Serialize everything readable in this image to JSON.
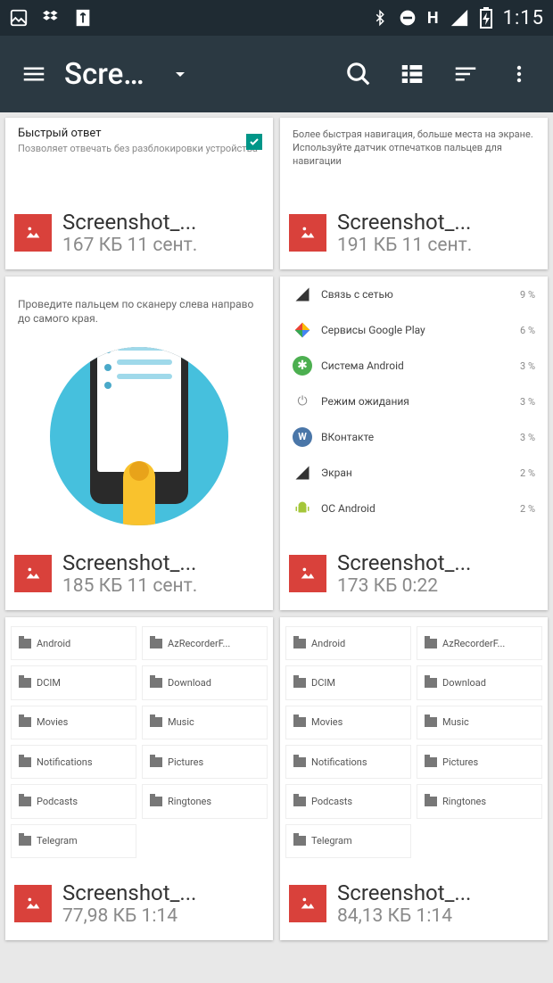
{
  "status": {
    "clock": "1:15",
    "network_label": "H"
  },
  "appbar": {
    "title": "Scre…"
  },
  "cards": [
    {
      "name": "Screenshot_...",
      "size": "167 КБ",
      "date": "11 сент.",
      "pv1": {
        "title": "Быстрый ответ",
        "subtitle": "Позволяет отвечать без разблокировки устройства"
      }
    },
    {
      "name": "Screenshot_...",
      "size": "191 КБ",
      "date": "11 сент.",
      "pv2": {
        "text": "Более быстрая навигация, больше места на экране. Используйте датчик отпечатков пальцев для навигации"
      }
    },
    {
      "name": "Screenshot_...",
      "size": "185 КБ",
      "date": "11 сент.",
      "pv3": {
        "hint": "Проведите пальцем по сканеру слева направо до самого края."
      }
    },
    {
      "name": "Screenshot_...",
      "size": "173 КБ",
      "date": "0:22",
      "pv4": {
        "items": [
          {
            "label": "Связь с сетью",
            "pct": "9 %",
            "color": "#333"
          },
          {
            "label": "Сервисы Google Play",
            "pct": "6 %",
            "color": "#ea4335"
          },
          {
            "label": "Система Android",
            "pct": "3 %",
            "color": "#4caf50"
          },
          {
            "label": "Режим ожидания",
            "pct": "3 %",
            "color": "#888"
          },
          {
            "label": "ВКонтакте",
            "pct": "3 %",
            "color": "#4a76a8"
          },
          {
            "label": "Экран",
            "pct": "2 %",
            "color": "#333"
          },
          {
            "label": "ОС Android",
            "pct": "2 %",
            "color": "#a4c639"
          }
        ]
      }
    },
    {
      "name": "Screenshot_...",
      "size": "77,98 КБ",
      "date": "1:14",
      "pvF": {
        "folders": [
          "Android",
          "AzRecorderF...",
          "DCIM",
          "Download",
          "Movies",
          "Music",
          "Notifications",
          "Pictures",
          "Podcasts",
          "Ringtones",
          "Telegram"
        ]
      }
    },
    {
      "name": "Screenshot_...",
      "size": "84,13 КБ",
      "date": "1:14",
      "pvF": {
        "folders": [
          "Android",
          "AzRecorderF...",
          "DCIM",
          "Download",
          "Movies",
          "Music",
          "Notifications",
          "Pictures",
          "Podcasts",
          "Ringtones",
          "Telegram"
        ]
      }
    }
  ]
}
